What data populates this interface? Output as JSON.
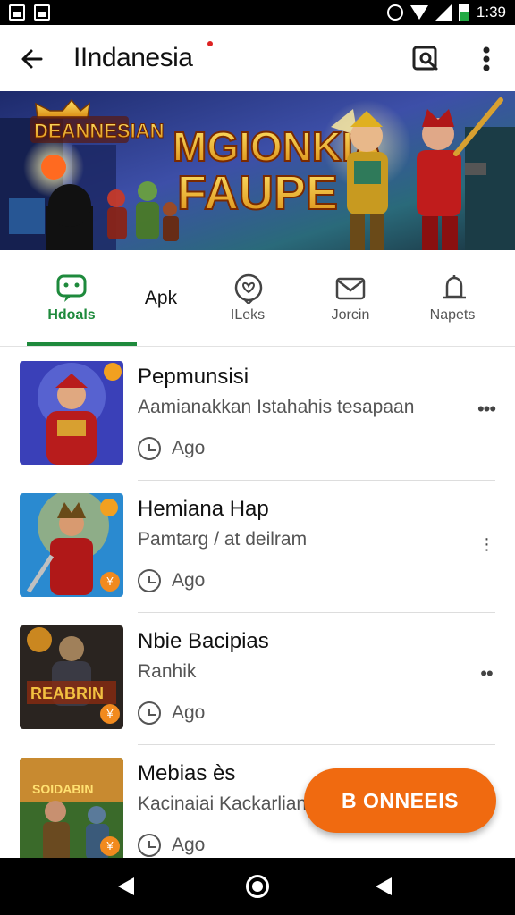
{
  "status_bar": {
    "time": "1:39"
  },
  "app_bar": {
    "title": "IIndanesia"
  },
  "banner": {
    "logo_text": "DEANNESIAN",
    "headline_line1": "MGIONKIA",
    "headline_line2": "FAUPE"
  },
  "tabs": [
    {
      "label": "Hdoals",
      "icon": "chat-face-icon",
      "selected": true
    },
    {
      "label": "Apk",
      "icon": "",
      "selected": false
    },
    {
      "label": "ILeks",
      "icon": "heart-face-icon",
      "selected": false
    },
    {
      "label": "Jorcin",
      "icon": "mail-icon",
      "selected": false
    },
    {
      "label": "Napets",
      "icon": "bell-icon",
      "selected": false
    }
  ],
  "list": [
    {
      "name": "Pepmunsisi",
      "subtitle": "Aamianakkan Istahahis tesapaan",
      "time": "Ago",
      "badge": ""
    },
    {
      "name": "Hemiana Hap",
      "subtitle": "Pamtarg / at deilram",
      "time": "Ago",
      "badge": "¥"
    },
    {
      "name": "Nbie Bacipias",
      "subtitle": "Ranhik",
      "time": "Ago",
      "badge": "¥"
    },
    {
      "name": "Mebias ès",
      "subtitle": "Kacinaiai Kackarlian",
      "time": "Ago",
      "badge": "¥"
    }
  ],
  "fab": {
    "label": "B ONNEEIS"
  },
  "colors": {
    "accent_green": "#1e8a3c",
    "fab_orange": "#f06a10",
    "badge_orange": "#f28a1e"
  }
}
